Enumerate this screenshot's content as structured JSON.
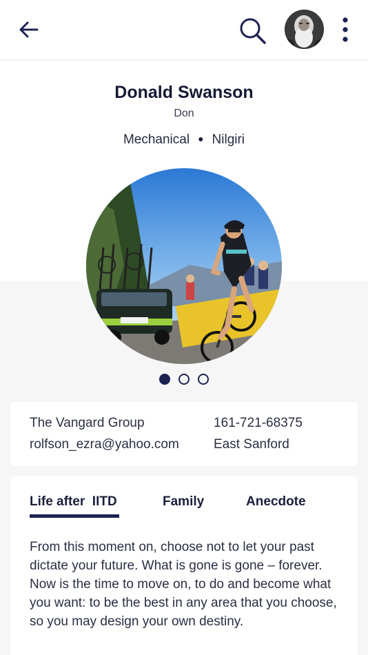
{
  "header": {
    "back_icon": "arrow-left-icon",
    "search_icon": "search-icon",
    "more_icon": "more-vertical-icon",
    "avatar_alt": "user avatar"
  },
  "profile": {
    "name": "Donald Swanson",
    "nickname": "Don",
    "department": "Mechanical",
    "hostel": "Nilgiri"
  },
  "carousel": {
    "active_index": 0,
    "count": 3
  },
  "contact": {
    "company": "The Vangard Group",
    "phone": "161-721-68375",
    "email": "rolfson_ezra@yahoo.com",
    "location": "East Sanford"
  },
  "tabs": [
    {
      "label": "Life after  IITD",
      "active": true
    },
    {
      "label": "Family",
      "active": false
    },
    {
      "label": "Anecdote",
      "active": false
    }
  ],
  "story": {
    "text": "From this moment on, choose not to let your past dictate your future. What is gone is gone – forever. Now is the time to move on, to do and become what you want: to be the best in any area that you choose, so you may design your own destiny."
  },
  "colors": {
    "primary": "#1c2250",
    "background": "#f6f6f7",
    "card": "#ffffff"
  }
}
